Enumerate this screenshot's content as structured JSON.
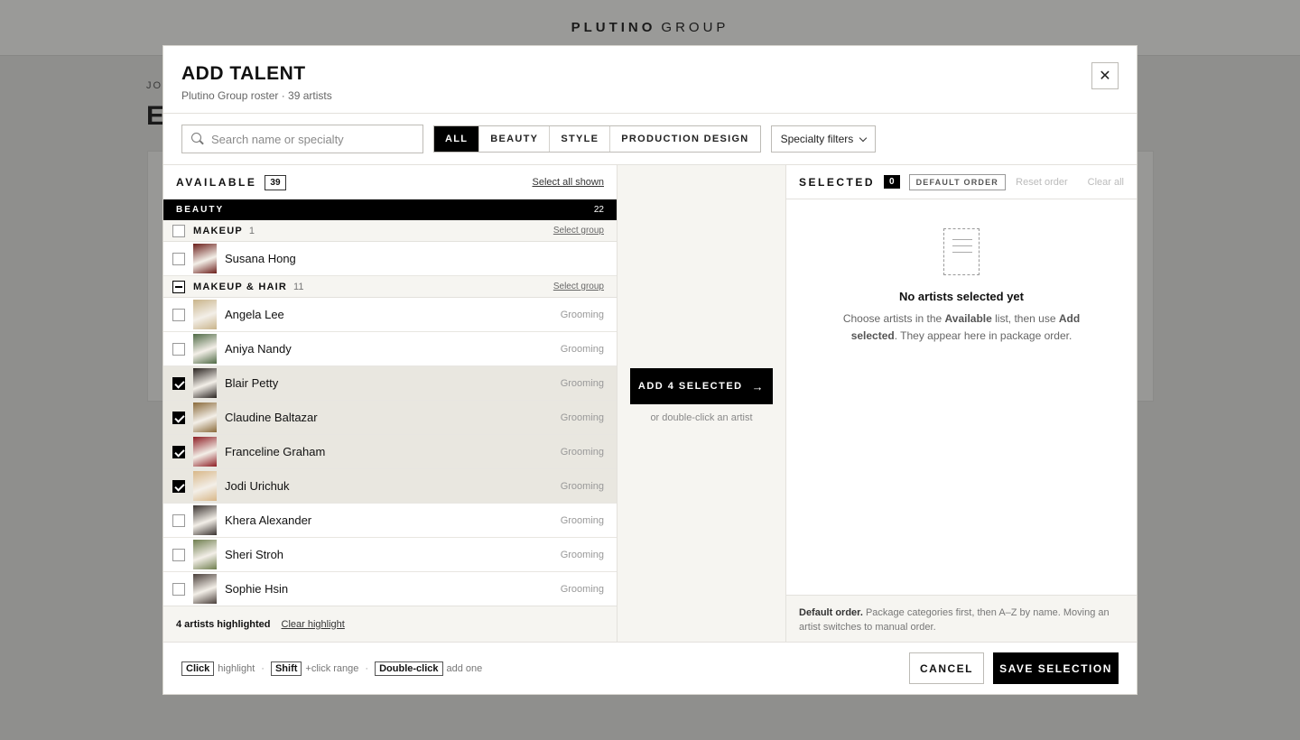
{
  "background": {
    "brand_bold": "PLUTINO",
    "brand_light": "GROUP",
    "crumb": "JO",
    "title": "E"
  },
  "modal": {
    "title": "ADD TALENT",
    "subtitle": "Plutino Group roster · 39 artists",
    "close_icon": "close-icon"
  },
  "toolbar": {
    "search_placeholder": "Search name or specialty",
    "search_value": "",
    "tabs": [
      {
        "label": "ALL",
        "active": true
      },
      {
        "label": "BEAUTY",
        "active": false
      },
      {
        "label": "STYLE",
        "active": false
      },
      {
        "label": "PRODUCTION DESIGN",
        "active": false
      }
    ],
    "filter_label": "Specialty filters"
  },
  "available": {
    "label": "AVAILABLE",
    "count": "39",
    "select_all": "Select all shown",
    "category": {
      "label": "BEAUTY",
      "count": "22"
    },
    "groups": [
      {
        "label": "MAKEUP",
        "count": "1",
        "select_label": "Select group",
        "state": "none",
        "artists": [
          {
            "name": "Susana Hong",
            "specialty": "",
            "checked": false,
            "avatar_color": "#6b1e1a"
          }
        ]
      },
      {
        "label": "MAKEUP & HAIR",
        "count": "11",
        "select_label": "Select group",
        "state": "partial",
        "artists": [
          {
            "name": "Angela Lee",
            "specialty": "Grooming",
            "checked": false,
            "avatar_color": "#c9b48a"
          },
          {
            "name": "Aniya Nandy",
            "specialty": "Grooming",
            "checked": false,
            "avatar_color": "#4f6a45"
          },
          {
            "name": "Blair Petty",
            "specialty": "Grooming",
            "checked": true,
            "avatar_color": "#2a2421"
          },
          {
            "name": "Claudine Baltazar",
            "specialty": "Grooming",
            "checked": true,
            "avatar_color": "#8a6a3a"
          },
          {
            "name": "Franceline Graham",
            "specialty": "Grooming",
            "checked": true,
            "avatar_color": "#8e1d24"
          },
          {
            "name": "Jodi Urichuk",
            "specialty": "Grooming",
            "checked": true,
            "avatar_color": "#d8b788"
          },
          {
            "name": "Khera Alexander",
            "specialty": "Grooming",
            "checked": false,
            "avatar_color": "#3a3330"
          },
          {
            "name": "Sheri Stroh",
            "specialty": "Grooming",
            "checked": false,
            "avatar_color": "#6f7e4e"
          },
          {
            "name": "Sophie Hsin",
            "specialty": "Grooming",
            "checked": false,
            "avatar_color": "#4a3f3a"
          }
        ]
      }
    ],
    "footer": {
      "highlight_count": "4 artists highlighted",
      "clear_label": "Clear highlight"
    }
  },
  "middle": {
    "add_label": "ADD 4 SELECTED",
    "arrow_icon": "arrow-right-icon",
    "hint": "or double-click an artist"
  },
  "selected": {
    "label": "SELECTED",
    "count": "0",
    "order_badge": "DEFAULT ORDER",
    "reset_label": "Reset order",
    "clear_label": "Clear all",
    "empty_title": "No artists selected yet",
    "empty_pre": "Choose artists in the ",
    "empty_b1": "Available",
    "empty_mid": " list, then use ",
    "empty_b2": "Add selected",
    "empty_post": ". They appear here in package order.",
    "footer_bold": "Default order.",
    "footer_text": " Package categories first, then A–Z by name. Moving an artist switches to manual order."
  },
  "footer": {
    "hints": [
      {
        "key": "Click",
        "text": "highlight"
      },
      {
        "key": "Shift",
        "text": "+click range"
      },
      {
        "key": "Double-click",
        "text": "add one"
      }
    ],
    "cancel_label": "CANCEL",
    "save_label": "SAVE SELECTION"
  }
}
